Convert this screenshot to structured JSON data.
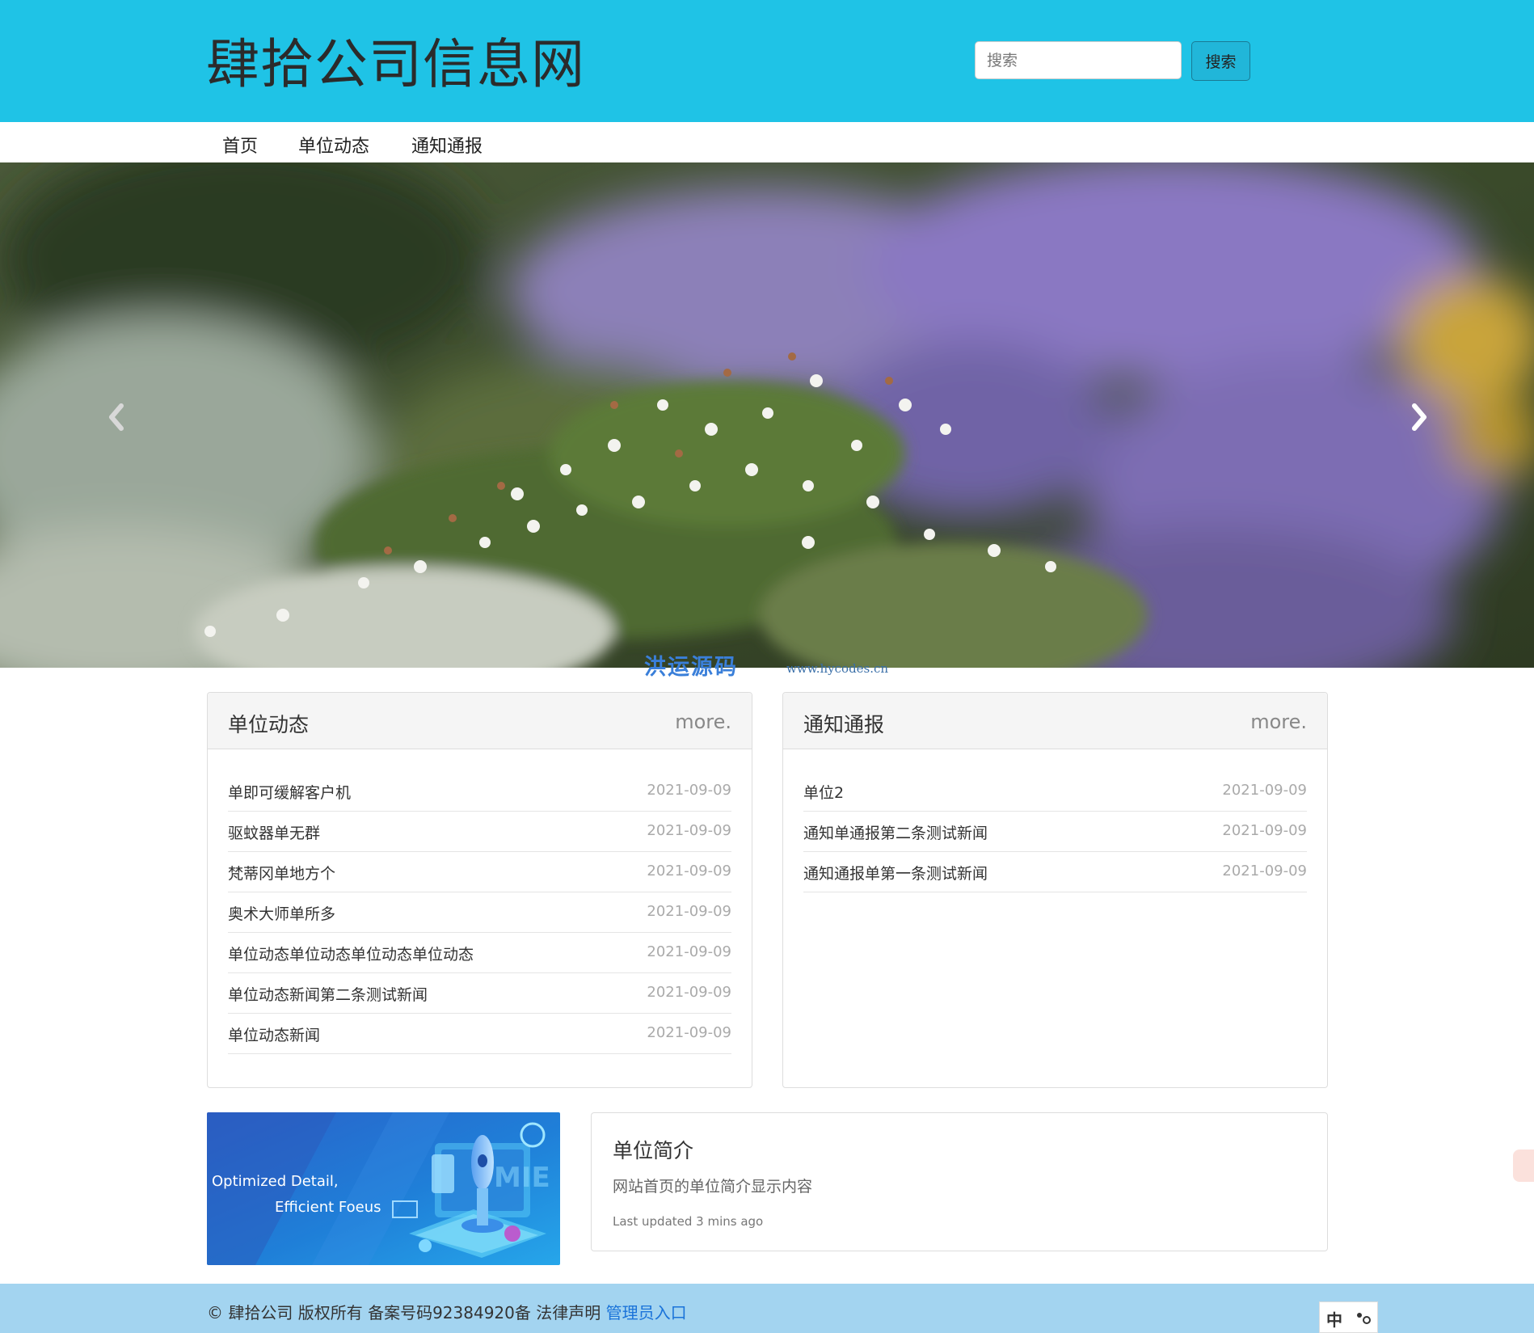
{
  "header": {
    "site_title": "肆拾公司信息网",
    "search_placeholder": "搜索",
    "search_button": "搜索"
  },
  "nav": {
    "items": [
      "首页",
      "单位动态",
      "通知通报"
    ]
  },
  "watermark": {
    "text": "洪运源码",
    "url": "www.hycodes.cn"
  },
  "unit_news": {
    "title": "单位动态",
    "more": "more.",
    "items": [
      {
        "title": "单即可缓解客户机",
        "date": "2021-09-09"
      },
      {
        "title": "驱蚊器单无群",
        "date": "2021-09-09"
      },
      {
        "title": "梵蒂冈单地方个",
        "date": "2021-09-09"
      },
      {
        "title": "奥术大师单所多",
        "date": "2021-09-09"
      },
      {
        "title": "单位动态单位动态单位动态单位动态",
        "date": "2021-09-09"
      },
      {
        "title": "单位动态新闻第二条测试新闻",
        "date": "2021-09-09"
      },
      {
        "title": "单位动态新闻",
        "date": "2021-09-09"
      }
    ]
  },
  "notices": {
    "title": "通知通报",
    "more": "more.",
    "items": [
      {
        "title": "单位2",
        "date": "2021-09-09"
      },
      {
        "title": "通知单通报第二条测试新闻",
        "date": "2021-09-09"
      },
      {
        "title": "通知通报单第一条测试新闻",
        "date": "2021-09-09"
      }
    ]
  },
  "banner": {
    "line1": "Optimized Detail,",
    "line2": "Efficient Foeus"
  },
  "intro": {
    "title": "单位简介",
    "text": "网站首页的单位简介显示内容",
    "updated": "Last updated 3 mins ago"
  },
  "footer": {
    "text": "© 肆拾公司 版权所有 备案号码92384920备 法律声明",
    "admin_link": "管理员入口"
  },
  "ime": {
    "label": "中"
  },
  "colors": {
    "header_bg": "#1fc3e6",
    "footer_bg": "#a3d4f0",
    "link": "#1a73d9"
  },
  "icons": {
    "carousel_prev": "chevron-left-icon",
    "carousel_next": "chevron-right-icon"
  }
}
